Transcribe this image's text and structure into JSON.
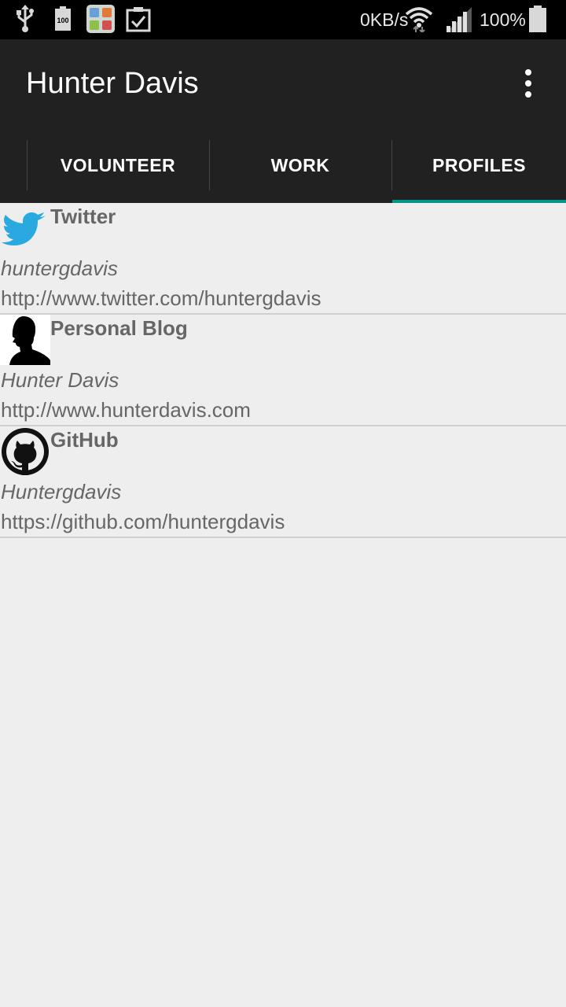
{
  "status_bar": {
    "icons": [
      "usb-icon",
      "battery-100-icon",
      "apps-grid-icon",
      "clipboard-check-icon",
      "wifi-icon",
      "cell-signal-icon",
      "battery-icon"
    ],
    "data_rate": "0KB/s",
    "battery_percent": "100%"
  },
  "app": {
    "title": "Hunter Davis",
    "overflow_icon": "more-vert-icon"
  },
  "tabs": [
    {
      "label": "VOLUNTEER",
      "selected": false
    },
    {
      "label": "WORK",
      "selected": false
    },
    {
      "label": "PROFILES",
      "selected": true
    }
  ],
  "colors": {
    "tab_indicator": "#009688",
    "bar_background": "#212121",
    "content_background": "#eeeeee",
    "text_gray": "#666666"
  },
  "profiles": [
    {
      "network": "Twitter",
      "username": "huntergdavis",
      "url": "http://www.twitter.com/huntergdavis",
      "icon": "twitter-bird-icon"
    },
    {
      "network": "Personal Blog",
      "username": "Hunter Davis",
      "url": "http://www.hunterdavis.com",
      "icon": "person-silhouette-icon"
    },
    {
      "network": "GitHub",
      "username": "Huntergdavis",
      "url": "https://github.com/huntergdavis",
      "icon": "github-octocat-icon"
    }
  ]
}
